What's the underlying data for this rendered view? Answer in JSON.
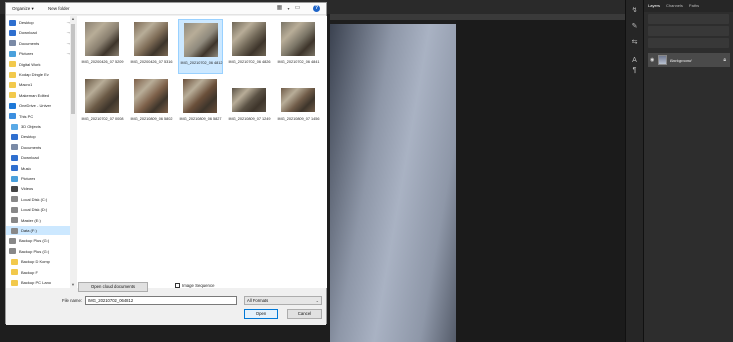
{
  "dialog": {
    "toolbar": {
      "organize": "Organize ▾",
      "new_folder": "New folder"
    },
    "nav": [
      {
        "label": "Desktop",
        "icon": "desktop-icon",
        "color": "#2f6fcf",
        "pin": true
      },
      {
        "label": "Download",
        "icon": "download-icon",
        "color": "#2f6fcf",
        "pin": true
      },
      {
        "label": "Documents",
        "icon": "documents-icon",
        "color": "#7a8aa6",
        "pin": true
      },
      {
        "label": "Pictures",
        "icon": "pictures-icon",
        "color": "#4aa0dc",
        "pin": true
      },
      {
        "label": "Digital Work",
        "icon": "folder-icon",
        "color": "#f2c94c",
        "pin": false
      },
      {
        "label": "Kodap Dingle Ev",
        "icon": "folder-icon",
        "color": "#f2c94c",
        "pin": false
      },
      {
        "label": "Macro1",
        "icon": "folder-icon",
        "color": "#f2c94c",
        "pin": false
      },
      {
        "label": "Makeman Edited",
        "icon": "folder-icon",
        "color": "#f2c94c",
        "pin": false
      },
      {
        "label": "OneDrive - Univer",
        "icon": "onedrive-icon",
        "color": "#1e78d7",
        "pin": false
      },
      {
        "label": "This PC",
        "icon": "this-pc-icon",
        "color": "#3c8fe0",
        "pin": false
      },
      {
        "label": "3D Objects",
        "icon": "3d-objects-icon",
        "color": "#5aa9e6",
        "pin": false
      },
      {
        "label": "Desktop",
        "icon": "desktop-icon",
        "color": "#2f6fcf",
        "pin": false
      },
      {
        "label": "Documents",
        "icon": "documents-icon",
        "color": "#7a8aa6",
        "pin": false
      },
      {
        "label": "Download",
        "icon": "download-icon",
        "color": "#2f6fcf",
        "pin": false
      },
      {
        "label": "Music",
        "icon": "music-icon",
        "color": "#2f6fcf",
        "pin": false
      },
      {
        "label": "Pictures",
        "icon": "pictures-icon",
        "color": "#4aa0dc",
        "pin": false
      },
      {
        "label": "Videos",
        "icon": "videos-icon",
        "color": "#444444",
        "pin": false
      },
      {
        "label": "Local Disk (C:)",
        "icon": "drive-icon",
        "color": "#888888",
        "pin": false
      },
      {
        "label": "Local Disk (D:)",
        "icon": "drive-icon",
        "color": "#888888",
        "pin": false
      },
      {
        "label": "Master (E:)",
        "icon": "drive-icon",
        "color": "#888888",
        "pin": false
      },
      {
        "label": "Data (F:)",
        "icon": "drive-icon",
        "color": "#888888",
        "pin": false
      },
      {
        "label": "Backup Plus (G:)",
        "icon": "network-drive-icon",
        "color": "#888888",
        "pin": false
      },
      {
        "label": "Backup Plus (G:)",
        "icon": "network-drive-icon",
        "color": "#888888",
        "pin": false
      },
      {
        "label": "Backup D Komp",
        "icon": "folder-icon",
        "color": "#f2c94c",
        "pin": false
      },
      {
        "label": "Backup F",
        "icon": "folder-icon",
        "color": "#f2c94c",
        "pin": false
      },
      {
        "label": "Backup PC Lano",
        "icon": "folder-icon",
        "color": "#f2c94c",
        "pin": false
      }
    ],
    "selected_nav_index": 20,
    "files": [
      {
        "name": "IMG_20200426_07 5209",
        "tone": "#8a8070"
      },
      {
        "name": "IMG_20200426_07 5316",
        "tone": "#7c6a55"
      },
      {
        "name": "IMG_20210702_06 4812",
        "tone": "#8f8a7d",
        "selected": true
      },
      {
        "name": "IMG_20210702_06 4826",
        "tone": "#6f6656"
      },
      {
        "name": "IMG_20210702_06 4841",
        "tone": "#7a7466"
      },
      {
        "name": "IMG_20210702_07 0008",
        "tone": "#6b5a46"
      },
      {
        "name": "IMG_20210809_06 5802",
        "tone": "#7d6049"
      },
      {
        "name": "IMG_20210809_06 5827",
        "tone": "#6a4f3a"
      },
      {
        "name": "IMG_20210809_07 1249",
        "tone": "#5b5245"
      },
      {
        "name": "IMG_20210809_07 1456",
        "tone": "#705c49"
      }
    ],
    "open_cloud_label": "Open cloud documents",
    "image_sequence_label": "Image Sequence",
    "file_name_label": "File name:",
    "file_name_value": "IMG_20210702_064812",
    "format_value": "All Formats",
    "open_label": "Open",
    "cancel_label": "Cancel"
  },
  "photoshop": {
    "tabs": [
      "Layers",
      "Channels",
      "Paths"
    ],
    "layer_name": "Background"
  }
}
